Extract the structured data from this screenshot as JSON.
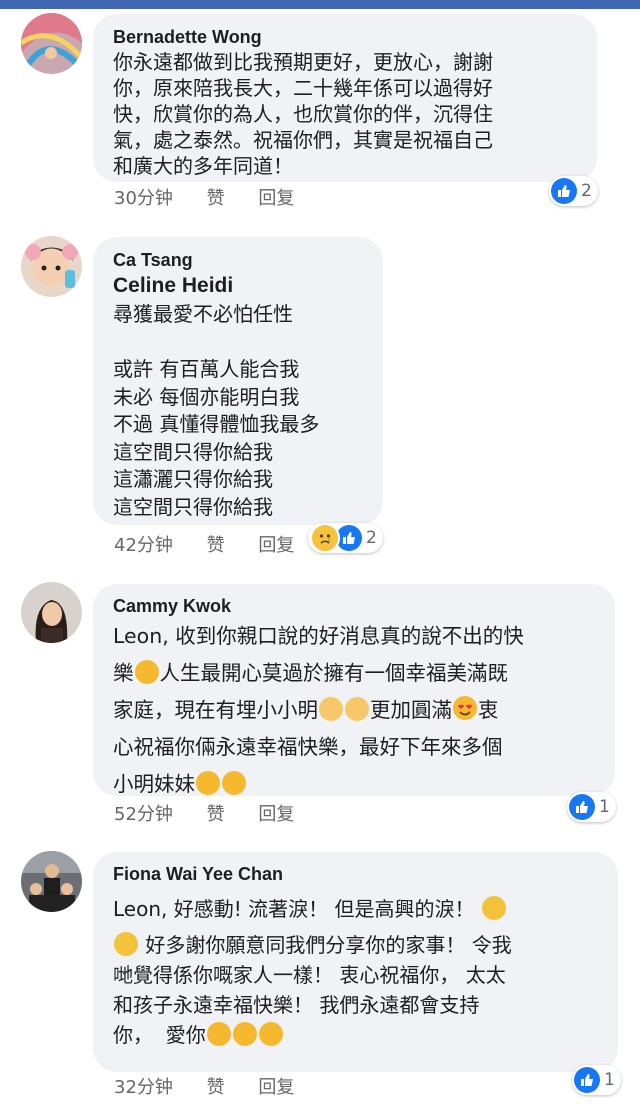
{
  "comments": [
    {
      "name": "Bernadette Wong",
      "text": "你永遠都做到比我預期更好，更放心，謝謝\n你，原來陪我長大，二十幾年係可以過得好\n快，欣賞你的為人，也欣賞你的伴，沉得住\n氣，處之泰然。祝福你們，其實是祝福自己\n和廣大的多年同道！",
      "time": "30分钟",
      "like_label": "赞",
      "reply_label": "回复",
      "reactions": "2"
    },
    {
      "name": "Ca Tsang",
      "tag": "Celine Heidi",
      "text": "尋獲最愛不必怕任性\n\n或許 有百萬人能合我\n未必 每個亦能明白我\n不過 真懂得體恤我最多\n這空間只得你給我\n這瀟灑只得你給我\n這空間只得你給我",
      "time": "42分钟",
      "like_label": "赞",
      "reply_label": "回复",
      "reactions": "2"
    },
    {
      "name": "Cammy Kwok",
      "text_parts": [
        "Leon, 收到你親口說的好消息真的說不出的快\n樂",
        "人生最開心莫過於擁有一個幸福美滿既\n家庭，現在有埋小小明",
        "更加圓滿",
        "衷\n心祝福你倆永遠幸福快樂，最好下年來多個\n小明妹妹"
      ],
      "time": "52分钟",
      "like_label": "赞",
      "reply_label": "回复",
      "reactions": "1"
    },
    {
      "name": "Fiona Wai Yee Chan",
      "text_parts": [
        "Leon, 好感動! 流著淚！ 但是高興的淚！ ",
        "好多謝你願意同我們分享你的家事！ 令我\n哋覺得係你嘅家人一樣！ 衷心祝福你， 太太\n和孩子永遠幸福快樂！ 我們永遠都會支持\n你，  愛你"
      ],
      "time": "32分钟",
      "like_label": "赞",
      "reply_label": "回复",
      "reactions": "1"
    }
  ],
  "colors": {
    "bubble": "#f0f2f5",
    "like_blue": "#1877f2",
    "meta_gray": "#65676b",
    "topbar": "#4267b2"
  },
  "icons": [
    "like-icon",
    "sad-icon",
    "hugging-face-emoji",
    "baby-emoji",
    "heart-eyes-emoji",
    "grinning-emoji",
    "crying-emoji",
    "kiss-emoji"
  ]
}
